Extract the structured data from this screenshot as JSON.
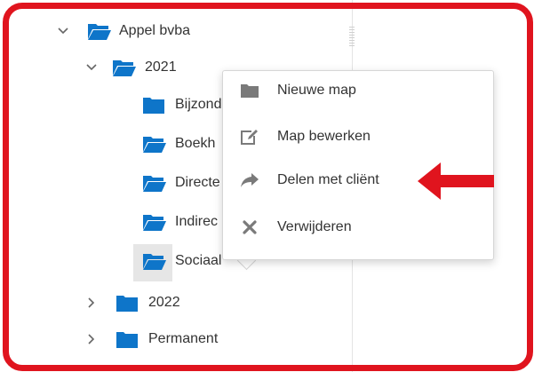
{
  "colors": {
    "folder": "#0e75c9",
    "frame": "#e0141e",
    "arrow": "#e0141e",
    "menu_icon": "#7a7a7a"
  },
  "tree": {
    "root": {
      "label": "Appel bvba",
      "icon": "folder-open-icon",
      "expanded": true
    },
    "year_2021": {
      "label": "2021",
      "icon": "folder-open-icon",
      "expanded": true
    },
    "children_2021": [
      {
        "label": "Bijzond",
        "icon": "folder-icon"
      },
      {
        "label": "Boekh",
        "icon": "folder-open-icon"
      },
      {
        "label": "Directe",
        "icon": "folder-open-icon"
      },
      {
        "label": "Indirec",
        "icon": "folder-open-icon"
      },
      {
        "label": "Sociaal",
        "icon": "folder-open-icon",
        "selected": true
      }
    ],
    "year_2022": {
      "label": "2022",
      "icon": "folder-icon",
      "expanded": false
    },
    "permanent": {
      "label": "Permanent",
      "icon": "folder-icon",
      "expanded": false
    }
  },
  "context_menu": {
    "items": [
      {
        "label": "Nieuwe map",
        "icon": "folder-icon"
      },
      {
        "label": "Map bewerken",
        "icon": "edit-icon"
      },
      {
        "label": "Delen met cliënt",
        "icon": "share-icon"
      },
      {
        "label": "Verwijderen",
        "icon": "delete-icon"
      }
    ]
  }
}
